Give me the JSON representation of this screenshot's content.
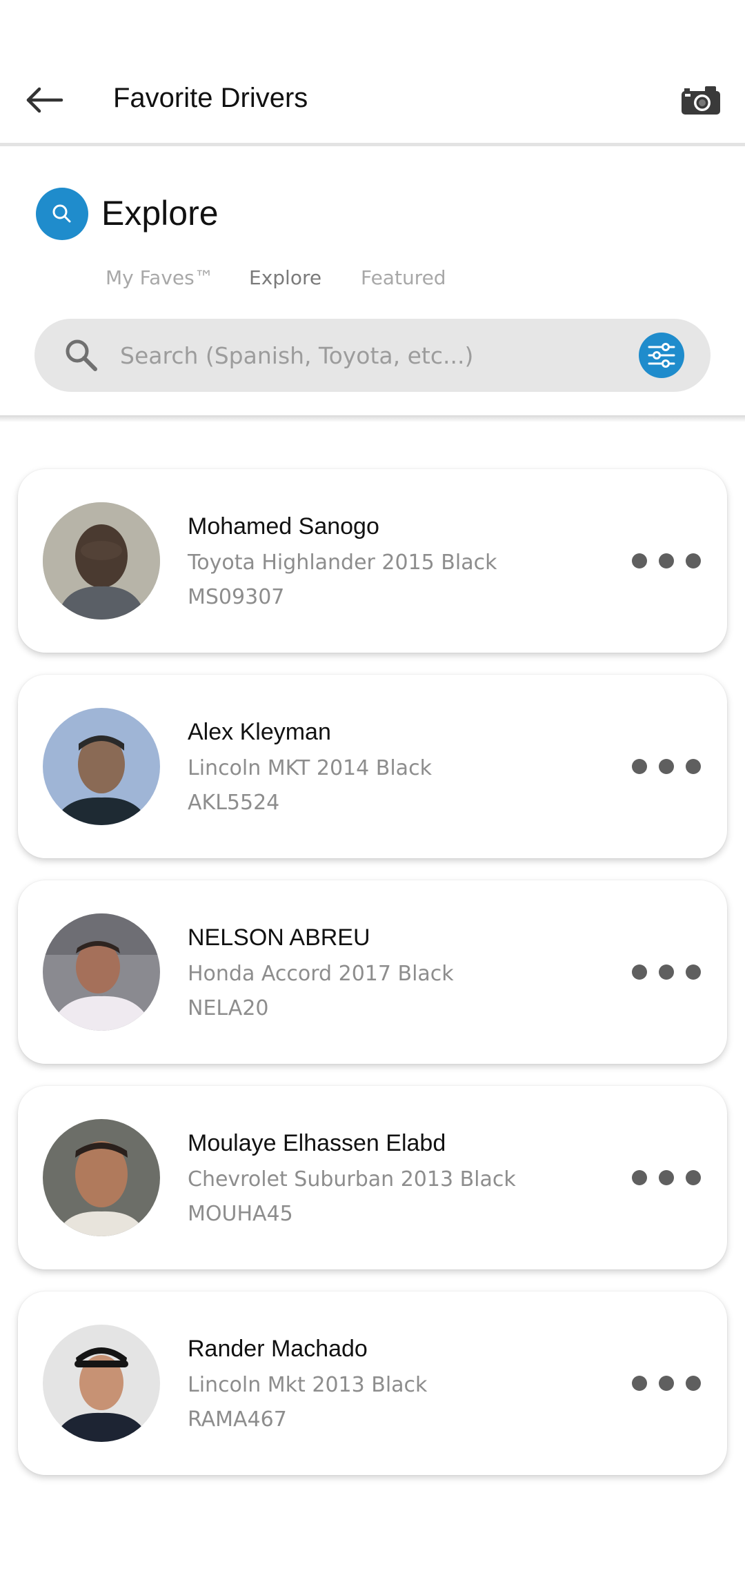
{
  "header": {
    "title": "Favorite Drivers",
    "back_icon": "arrow-left-icon",
    "camera_icon": "camera-icon"
  },
  "explore": {
    "title": "Explore",
    "icon": "search-icon",
    "tabs": [
      {
        "label": "My Faves™",
        "active": false
      },
      {
        "label": "Explore",
        "active": true
      },
      {
        "label": "Featured",
        "active": false
      }
    ],
    "search": {
      "placeholder": "Search (Spanish, Toyota, etc...)",
      "value": "",
      "filter_icon": "sliders-icon"
    }
  },
  "drivers": [
    {
      "name": "Mohamed Sanogo",
      "vehicle": "Toyota Highlander 2015 Black",
      "plate": "MS09307"
    },
    {
      "name": "Alex Kleyman",
      "vehicle": "Lincoln MKT 2014 Black",
      "plate": "AKL5524"
    },
    {
      "name": "NELSON ABREU",
      "vehicle": "Honda Accord 2017 Black",
      "plate": "NELA20"
    },
    {
      "name": "Moulaye Elhassen Elabd",
      "vehicle": "Chevrolet Suburban 2013 Black",
      "plate": "MOUHA45"
    },
    {
      "name": "Rander Machado",
      "vehicle": "Lincoln Mkt 2013 Black",
      "plate": "RAMA467"
    }
  ],
  "colors": {
    "accent": "#1f8ccc",
    "more_dots": "#5f5f5f",
    "secondary_text": "#8d8d8d"
  }
}
